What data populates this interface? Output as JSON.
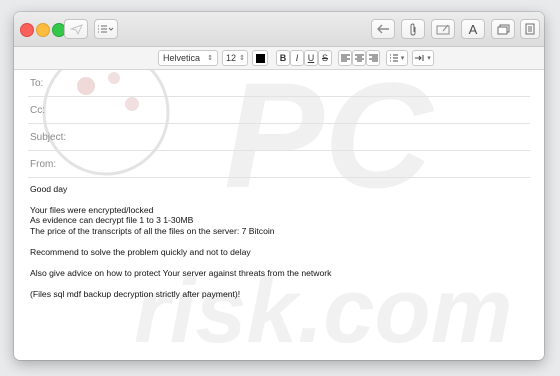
{
  "format_bar": {
    "font": "Helvetica",
    "size": "12",
    "bold": "B",
    "italic": "I",
    "underline": "U",
    "strike": "S"
  },
  "toolbar": {
    "format_icon_label": "A"
  },
  "fields": {
    "to": "To:",
    "cc": "Cc:",
    "subject": "Subject:",
    "from": "From:"
  },
  "message": {
    "lines": [
      "Good day",
      "",
      "Your files were encrypted/locked",
      "As evidence can decrypt file 1 to 3 1-30MB",
      "The price of the transcripts of all the files on the server: 7 Bitcoin",
      "",
      "Recommend to solve the problem quickly and not to delay",
      "",
      "Also give advice on how to protect Your server against threats from the network",
      "",
      "(Files sql mdf backup decryption strictly after payment)!"
    ]
  },
  "watermark": {
    "text_top": "PC",
    "text_bottom": "risk.com"
  }
}
